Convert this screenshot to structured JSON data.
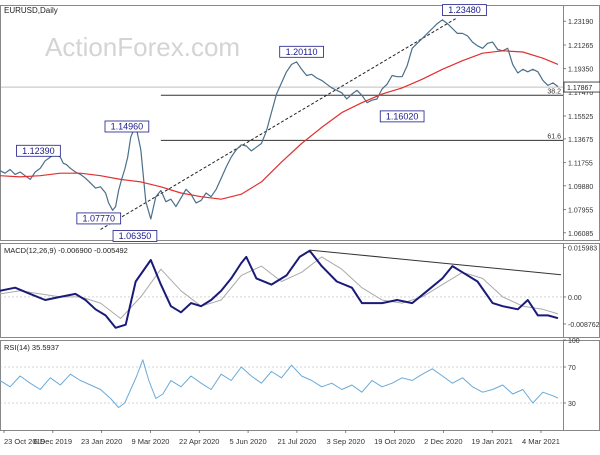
{
  "chart_data": {
    "type": "line",
    "panels": [
      {
        "id": "price",
        "title": "EURUSD,Daily",
        "ohlc": [
          "1.17898",
          "1.17930",
          "1.17621",
          "1.17867"
        ],
        "current_price_label": "1.17867",
        "watermark": "ActionForex.com",
        "ylim": [
          1.055,
          1.245
        ],
        "yticks": [
          "1.23190",
          "1.21265",
          "1.19350",
          "1.17470",
          "1.15525",
          "1.13675",
          "1.11755",
          "1.09880",
          "1.07955",
          "1.06085"
        ],
        "series": [
          {
            "name": "EURUSD",
            "color": "#4a6f8a",
            "x": [
              0,
              5,
              10,
              15,
              20,
              25,
              30,
              35,
              40,
              45,
              50,
              55,
              60,
              63,
              66,
              70,
              75,
              80,
              85,
              90,
              95,
              100,
              105,
              108,
              112,
              115,
              118,
              121,
              124,
              127,
              130,
              135,
              140,
              145,
              150,
              155,
              160,
              165,
              170,
              175,
              180,
              185,
              190,
              195,
              200,
              205,
              210,
              215,
              220,
              225,
              230,
              235,
              240,
              245,
              250,
              255,
              260,
              265,
              270,
              275,
              280,
              285,
              290,
              295,
              300,
              305,
              310,
              315,
              320,
              325,
              330,
              335,
              340,
              345,
              350,
              355,
              360,
              365,
              370,
              375,
              380,
              385,
              390,
              395,
              400,
              405,
              410,
              415,
              420,
              425,
              430,
              435,
              440,
              445,
              450,
              455,
              460,
              465,
              470,
              475,
              480,
              485,
              490,
              495,
              500,
              505,
              510,
              515,
              520,
              525,
              530,
              535,
              540,
              545,
              550,
              555
            ],
            "y": [
              1.111,
              1.109,
              1.112,
              1.108,
              1.11,
              1.107,
              1.104,
              1.11,
              1.113,
              1.119,
              1.122,
              1.125,
              1.122,
              1.117,
              1.116,
              1.113,
              1.11,
              1.108,
              1.105,
              1.101,
              1.097,
              1.098,
              1.093,
              1.085,
              1.079,
              1.082,
              1.095,
              1.104,
              1.112,
              1.122,
              1.138,
              1.148,
              1.128,
              1.086,
              1.072,
              1.09,
              1.095,
              1.086,
              1.088,
              1.082,
              1.089,
              1.096,
              1.092,
              1.085,
              1.087,
              1.093,
              1.09,
              1.096,
              1.105,
              1.114,
              1.122,
              1.128,
              1.132,
              1.131,
              1.127,
              1.13,
              1.133,
              1.143,
              1.158,
              1.173,
              1.182,
              1.191,
              1.197,
              1.199,
              1.193,
              1.188,
              1.189,
              1.186,
              1.184,
              1.181,
              1.178,
              1.176,
              1.174,
              1.169,
              1.173,
              1.176,
              1.172,
              1.166,
              1.168,
              1.169,
              1.177,
              1.181,
              1.188,
              1.187,
              1.187,
              1.196,
              1.21,
              1.214,
              1.218,
              1.222,
              1.226,
              1.23,
              1.233,
              1.23,
              1.226,
              1.222,
              1.222,
              1.22,
              1.215,
              1.212,
              1.21,
              1.214,
              1.215,
              1.209,
              1.208,
              1.21,
              1.197,
              1.19,
              1.193,
              1.191,
              1.193,
              1.191,
              1.184,
              1.18,
              1.182,
              1.179
            ]
          },
          {
            "name": "MA",
            "color": "#e03030",
            "x": [
              0,
              20,
              40,
              60,
              80,
              100,
              120,
              140,
              160,
              180,
              200,
              220,
              240,
              260,
              280,
              300,
              320,
              340,
              360,
              380,
              400,
              420,
              440,
              460,
              480,
              500,
              520,
              540,
              555
            ],
            "y": [
              1.107,
              1.106,
              1.107,
              1.109,
              1.109,
              1.107,
              1.104,
              1.102,
              1.098,
              1.093,
              1.09,
              1.088,
              1.092,
              1.102,
              1.118,
              1.133,
              1.146,
              1.158,
              1.166,
              1.173,
              1.178,
              1.185,
              1.193,
              1.2,
              1.206,
              1.208,
              1.207,
              1.202,
              1.197
            ]
          }
        ],
        "trendline": {
          "x": [
            100,
            455
          ],
          "y": [
            1.0635,
            1.2348
          ]
        },
        "levels": [
          {
            "label": "38.2",
            "value": 1.172,
            "x_start": 160
          },
          {
            "label": "61.6",
            "value": 1.1355,
            "x_start": 160
          }
        ],
        "annotations": [
          {
            "text": "1.23480",
            "x": 462,
            "y": 1.2348
          },
          {
            "text": "1.20110",
            "x": 300,
            "y": 1.2011
          },
          {
            "text": "1.16020",
            "x": 400,
            "y": 1.1602
          },
          {
            "text": "1.14960",
            "x": 150,
            "y": 1.1496
          },
          {
            "text": "1.12390",
            "x": 62,
            "y": 1.1239
          },
          {
            "text": "1.07770",
            "x": 122,
            "y": 1.0777
          },
          {
            "text": "1.06350",
            "x": 158,
            "y": 1.0635
          }
        ]
      },
      {
        "id": "macd",
        "title": "MACD(12,26,9) -0.006900 -0.005492",
        "ylim": [
          -0.013,
          0.0175
        ],
        "yticks": [
          "0.015983",
          "0.00",
          "-0.008762"
        ],
        "zero_line": 0,
        "series": [
          {
            "name": "MACD",
            "color": "#1a1a7a",
            "x": [
              0,
              15,
              30,
              45,
              60,
              75,
              85,
              95,
              105,
              115,
              125,
              135,
              150,
              160,
              170,
              180,
              190,
              200,
              210,
              220,
              230,
              240,
              245,
              255,
              270,
              285,
              298,
              308,
              320,
              335,
              350,
              360,
              370,
              380,
              395,
              410,
              425,
              440,
              450,
              460,
              475,
              490,
              500,
              515,
              525,
              535,
              545,
              555
            ],
            "y": [
              0.002,
              0.003,
              0.001,
              -0.001,
              0.0,
              0.001,
              -0.001,
              -0.004,
              -0.006,
              -0.01,
              -0.009,
              0.005,
              0.012,
              0.004,
              -0.003,
              -0.005,
              -0.002,
              -0.003,
              -0.001,
              0.002,
              0.006,
              0.011,
              0.013,
              0.006,
              0.004,
              0.007,
              0.013,
              0.015,
              0.01,
              0.005,
              0.003,
              -0.002,
              -0.002,
              -0.002,
              -0.001,
              -0.002,
              0.002,
              0.006,
              0.01,
              0.008,
              0.005,
              -0.002,
              -0.003,
              -0.004,
              -0.001,
              -0.006,
              -0.006,
              -0.0069
            ]
          },
          {
            "name": "Signal",
            "color": "#aaaaaa",
            "x": [
              0,
              20,
              40,
              60,
              80,
              100,
              120,
              140,
              160,
              180,
              200,
              220,
              240,
              260,
              280,
              300,
              320,
              340,
              360,
              380,
              400,
              420,
              440,
              460,
              480,
              500,
              520,
              540,
              555
            ],
            "y": [
              0.001,
              0.002,
              0.001,
              0.0,
              0.0,
              -0.002,
              -0.007,
              0.0,
              0.009,
              0.002,
              -0.003,
              -0.001,
              0.007,
              0.01,
              0.005,
              0.008,
              0.013,
              0.009,
              0.003,
              -0.001,
              -0.002,
              0.0,
              0.004,
              0.008,
              0.006,
              0.0,
              -0.003,
              -0.004,
              -0.0055
            ]
          }
        ],
        "trendline": {
          "x": [
            308,
            558
          ],
          "y": [
            0.0152,
            0.0072
          ]
        }
      },
      {
        "id": "rsi",
        "title": "RSI(14) 35.5937",
        "ylim": [
          0,
          100
        ],
        "yticks": [
          "100",
          "70",
          "30",
          "0"
        ],
        "levels": [
          70,
          30
        ],
        "series": [
          {
            "name": "RSI",
            "color": "#6aaad8",
            "x": [
              0,
              10,
              20,
              30,
              40,
              50,
              60,
              70,
              80,
              90,
              100,
              110,
              118,
              124,
              130,
              136,
              142,
              148,
              155,
              162,
              170,
              180,
              190,
              200,
              210,
              220,
              230,
              240,
              250,
              260,
              270,
              280,
              290,
              300,
              310,
              320,
              330,
              340,
              350,
              360,
              370,
              380,
              390,
              400,
              410,
              420,
              430,
              440,
              450,
              460,
              470,
              480,
              490,
              500,
              510,
              520,
              530,
              540,
              550,
              555
            ],
            "y": [
              55,
              48,
              60,
              52,
              45,
              58,
              50,
              62,
              55,
              50,
              45,
              35,
              25,
              30,
              45,
              60,
              78,
              55,
              35,
              40,
              55,
              48,
              60,
              52,
              45,
              62,
              55,
              70,
              60,
              52,
              65,
              58,
              72,
              60,
              55,
              48,
              52,
              45,
              50,
              42,
              55,
              48,
              52,
              58,
              55,
              62,
              68,
              60,
              52,
              58,
              48,
              42,
              45,
              50,
              40,
              45,
              30,
              42,
              38,
              35.6
            ]
          }
        ]
      }
    ],
    "x_tick_labels": [
      "23 Oct 2019",
      "6 Dec 2019",
      "23 Jan 2020",
      "9 Mar 2020",
      "22 Apr 2020",
      "5 Jun 2020",
      "21 Jul 2020",
      "3 Sep 2020",
      "19 Oct 2020",
      "2 Dec 2020",
      "19 Jan 2021",
      "4 Mar 2021"
    ]
  }
}
